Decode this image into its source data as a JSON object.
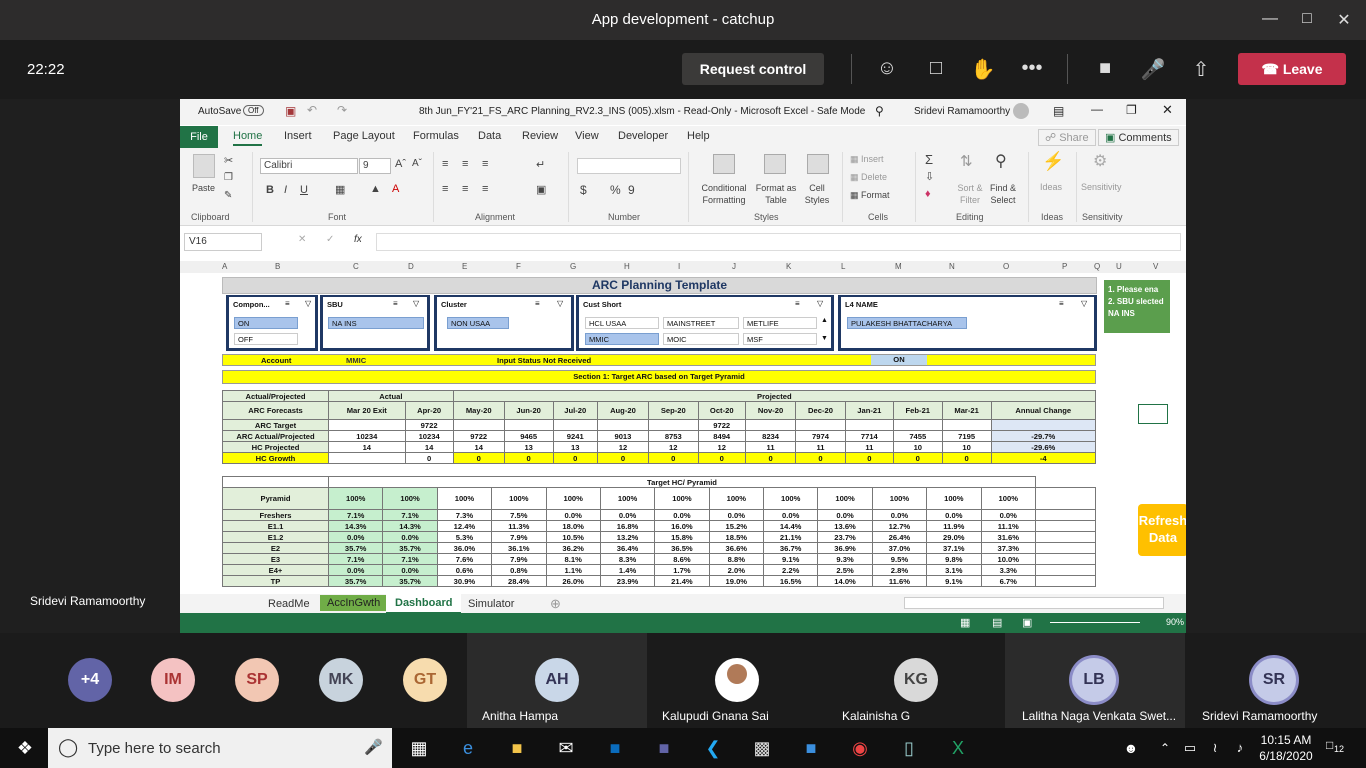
{
  "window": {
    "title": "App development - catchup"
  },
  "meeting": {
    "clock": "22:22",
    "request_control": "Request control",
    "leave": "Leave",
    "presenter": "Sridevi Ramamoorthy"
  },
  "excel": {
    "autosave": "AutoSave",
    "autosave_state": "Off",
    "file_title": "8th Jun_FY'21_FS_ARC Planning_RV2.3_INS (005).xlsm  -  Read-Only  -  Microsoft Excel  -  Safe Mode",
    "user": "Sridevi Ramamoorthy",
    "tabs": [
      "File",
      "Home",
      "Insert",
      "Page Layout",
      "Formulas",
      "Data",
      "Review",
      "View",
      "Developer",
      "Help"
    ],
    "share": "Share",
    "comments": "Comments",
    "ribbon": {
      "paste": "Paste",
      "font_name": "Calibri",
      "font_size": "9",
      "conditional": "Conditional Formatting",
      "format_table": "Format as Table",
      "cell_styles": "Cell Styles",
      "insert": "Insert",
      "delete": "Delete",
      "format": "Format",
      "sort": "Sort & Filter",
      "find": "Find & Select",
      "ideas": "Ideas",
      "sensitivity": "Sensitivity",
      "groups": [
        "Clipboard",
        "Font",
        "Alignment",
        "Number",
        "Styles",
        "Cells",
        "Editing",
        "Ideas",
        "Sensitivity"
      ]
    },
    "name_box": "V16",
    "columns": [
      "A",
      "B",
      "C",
      "D",
      "E",
      "F",
      "G",
      "H",
      "I",
      "J",
      "K",
      "L",
      "M",
      "N",
      "O",
      "P",
      "Q",
      "U",
      "V"
    ],
    "sheet_title": "ARC Planning Template",
    "slicers": {
      "component": {
        "title": "Compon...",
        "items": [
          "ON",
          "OFF"
        ]
      },
      "sbu": {
        "title": "SBU",
        "items": [
          "NA INS"
        ]
      },
      "cluster": {
        "title": "Cluster",
        "items": [
          "NON USAA"
        ]
      },
      "cust": {
        "title": "Cust Short",
        "items": [
          "HCL USAA",
          "MAINSTREET",
          "METLIFE",
          "MMIC",
          "MOIC",
          "MSF"
        ]
      },
      "l4": {
        "title": "L4 NAME",
        "items": [
          "PULAKESH BHATTACHARYA"
        ]
      }
    },
    "note": {
      "line1": "1. Please ena",
      "line2": "2. SBU slected",
      "line3": "NA INS"
    },
    "refresh": "Refresh Data",
    "account_row": {
      "label": "Account",
      "value": "MMIC",
      "status": "Input Status  Not Received",
      "on": "ON"
    },
    "section1": "Section 1: Target ARC based on Target Pyramid",
    "hdr_actual_proj": "Actual/Projected",
    "hdr_actual": "Actual",
    "hdr_projected": "Projected",
    "months": [
      "ARC Forecasts",
      "Mar 20 Exit",
      "Apr-20",
      "May-20",
      "Jun-20",
      "Jul-20",
      "Aug-20",
      "Sep-20",
      "Oct-20",
      "Nov-20",
      "Dec-20",
      "Jan-21",
      "Feb-21",
      "Mar-21",
      "Annual Change"
    ],
    "rows": [
      {
        "rn": "17",
        "cells": [
          "ARC Target",
          "",
          "9722",
          "",
          "",
          "",
          "",
          "",
          "9722",
          "",
          "",
          "",
          "",
          "",
          ""
        ]
      },
      {
        "rn": "18",
        "cells": [
          "ARC Actual/Projected",
          "10234",
          "10234",
          "9722",
          "9465",
          "9241",
          "9013",
          "8753",
          "8494",
          "8234",
          "7974",
          "7714",
          "7455",
          "7195",
          "-29.7%"
        ]
      },
      {
        "rn": "20",
        "cells": [
          "HC Projected",
          "14",
          "14",
          "14",
          "13",
          "13",
          "12",
          "12",
          "12",
          "11",
          "11",
          "11",
          "10",
          "10",
          "-29.6%"
        ]
      },
      {
        "rn": "24",
        "cells": [
          "HC Growth",
          "",
          "0",
          "0",
          "0",
          "0",
          "0",
          "0",
          "0",
          "0",
          "0",
          "0",
          "0",
          "0",
          "-4"
        ]
      }
    ],
    "target_hc": "Target HC/ Pyramid",
    "pyramid": [
      {
        "rn": "26",
        "cells": [
          "Pyramid",
          "100%",
          "100%",
          "100%",
          "100%",
          "100%",
          "100%",
          "100%",
          "100%",
          "100%",
          "100%",
          "100%",
          "100%",
          "100%"
        ]
      },
      {
        "rn": "27",
        "cells": [
          "Freshers",
          "7.1%",
          "7.1%",
          "7.3%",
          "7.5%",
          "0.0%",
          "0.0%",
          "0.0%",
          "0.0%",
          "0.0%",
          "0.0%",
          "0.0%",
          "0.0%",
          "0.0%"
        ]
      },
      {
        "rn": "28",
        "cells": [
          "E1.1",
          "14.3%",
          "14.3%",
          "12.4%",
          "11.3%",
          "18.0%",
          "16.8%",
          "16.0%",
          "15.2%",
          "14.4%",
          "13.6%",
          "12.7%",
          "11.9%",
          "11.1%"
        ]
      },
      {
        "rn": "29",
        "cells": [
          "E1.2",
          "0.0%",
          "0.0%",
          "5.3%",
          "7.9%",
          "10.5%",
          "13.2%",
          "15.8%",
          "18.5%",
          "21.1%",
          "23.7%",
          "26.4%",
          "29.0%",
          "31.6%"
        ]
      },
      {
        "rn": "30",
        "cells": [
          "E2",
          "35.7%",
          "35.7%",
          "36.0%",
          "36.1%",
          "36.2%",
          "36.4%",
          "36.5%",
          "36.6%",
          "36.7%",
          "36.9%",
          "37.0%",
          "37.1%",
          "37.3%"
        ]
      },
      {
        "rn": "31",
        "cells": [
          "E3",
          "7.1%",
          "7.1%",
          "7.6%",
          "7.9%",
          "8.1%",
          "8.3%",
          "8.6%",
          "8.8%",
          "9.1%",
          "9.3%",
          "9.5%",
          "9.8%",
          "10.0%"
        ]
      },
      {
        "rn": "32",
        "cells": [
          "E4+",
          "0.0%",
          "0.0%",
          "0.6%",
          "0.8%",
          "1.1%",
          "1.4%",
          "1.7%",
          "2.0%",
          "2.2%",
          "2.5%",
          "2.8%",
          "3.1%",
          "3.3%"
        ]
      },
      {
        "rn": "33",
        "cells": [
          "TP",
          "35.7%",
          "35.7%",
          "30.9%",
          "28.4%",
          "26.0%",
          "23.9%",
          "21.4%",
          "19.0%",
          "16.5%",
          "14.0%",
          "11.6%",
          "9.1%",
          "6.7%"
        ]
      }
    ],
    "sheets": [
      "ReadMe",
      "AccInGwth",
      "Dashboard",
      "Simulator"
    ],
    "zoom": "90%"
  },
  "participants": {
    "overflow": "+4",
    "small": [
      {
        "initials": "IM",
        "color": "#f4c2c2"
      },
      {
        "initials": "SP",
        "color": "#f2c7b3"
      },
      {
        "initials": "MK",
        "color": "#c8d3dd"
      },
      {
        "initials": "GT",
        "color": "#f7dcae"
      }
    ],
    "tiles": [
      {
        "initials": "AH",
        "name": "Anitha Hampa",
        "color": "#c9d7e8"
      },
      {
        "initials": "",
        "name": "Kalupudi Gnana Sai",
        "color": "#ffffff"
      },
      {
        "initials": "KG",
        "name": "Kalainisha G",
        "color": "#d9d9d9"
      },
      {
        "initials": "LB",
        "name": "Lalitha Naga Venkata Swet...",
        "color": "#c5cbe8"
      },
      {
        "initials": "SR",
        "name": "Sridevi Ramamoorthy",
        "color": "#c5cbe8"
      }
    ]
  },
  "taskbar": {
    "search": "Type here to search",
    "time": "10:15 AM",
    "date": "6/18/2020",
    "notif": "12"
  }
}
